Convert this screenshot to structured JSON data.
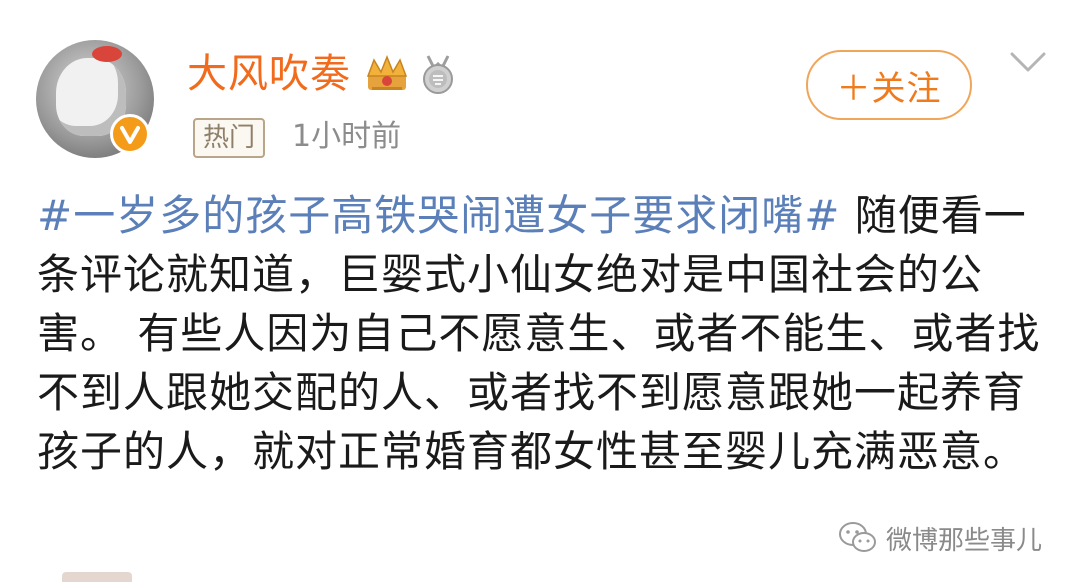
{
  "post": {
    "author": {
      "name": "大风吹奏",
      "avatar_icon": "cat-avatar",
      "verified_badge_color": "#f59b1a",
      "badges": [
        "crown-badge-icon",
        "medal-badge-icon"
      ]
    },
    "tag": "热门",
    "timestamp": "1小时前",
    "follow_label": "＋关注",
    "topic": "#一岁多的孩子高铁哭闹遭女子要求闭嘴#",
    "body_text": " 随便看一条评论就知道，巨婴式小仙女绝对是中国社会的公害。 有些人因为自己不愿意生、或者不能生、或者找不到人跟她交配的人、或者找不到愿意跟她一起养育孩子的人，就对正常婚育都女性甚至婴儿充满恶意。"
  },
  "watermark": {
    "text": "微博那些事儿",
    "icon": "wechat-icon"
  },
  "colors": {
    "username": "#f26a1b",
    "topic": "#5b7fb8",
    "follow": "#f07b1c",
    "timestamp": "#8c8c8c"
  }
}
